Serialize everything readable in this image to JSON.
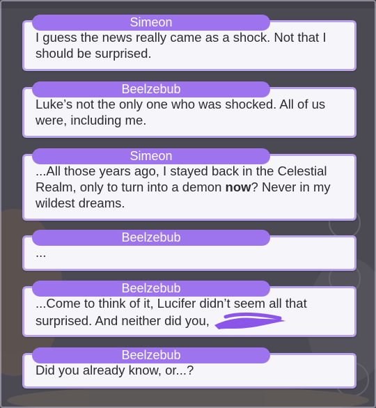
{
  "dialogue": [
    {
      "speaker": "Simeon",
      "text": "I guess the news really came as a shock. Not that I should be surprised."
    },
    {
      "speaker": "Beelzebub",
      "text": "Luke’s not the only one who was shocked. All of us were, including me."
    },
    {
      "speaker": "Simeon",
      "text_before": "...All those years ago, I stayed back in the Celestial Realm, only to turn into a demon ",
      "text_emphasis": "now",
      "text_after": "? Never in my wildest dreams."
    },
    {
      "speaker": "Beelzebub",
      "text": "..."
    },
    {
      "speaker": "Beelzebub",
      "text": "...Come to think of it, Lucifer didn’t seem all that surprised. And neither did you,"
    },
    {
      "speaker": "Beelzebub",
      "text": "Did you already know, or...?"
    }
  ],
  "colors": {
    "speaker_tag": "#9e74ee",
    "bubble_bg": "#f6f5fa",
    "bubble_border": "#b9a3ec",
    "text": "#2b2b30",
    "redaction": "#8a55e8"
  }
}
